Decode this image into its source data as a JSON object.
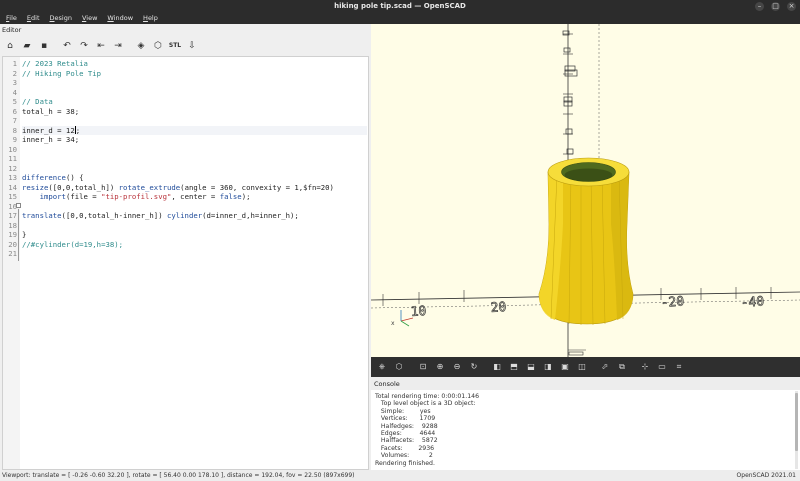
{
  "window": {
    "title": "hiking pole tip.scad — OpenSCAD",
    "minimize": "–",
    "maximize": "□",
    "close": "×"
  },
  "menu": [
    "File",
    "Edit",
    "Design",
    "View",
    "Window",
    "Help"
  ],
  "editor": {
    "header": "Editor",
    "toolbar_icons": [
      "new-icon",
      "open-icon",
      "save-icon",
      "undo-icon",
      "redo-icon",
      "unindent-icon",
      "indent-icon",
      "preview-icon",
      "render-icon",
      "export-stl-icon",
      "send-to-printer-icon"
    ],
    "lines": [
      {
        "n": "1",
        "text": "// 2023 Retalia"
      },
      {
        "n": "2",
        "text": "// Hiking Pole Tip"
      },
      {
        "n": "3",
        "text": ""
      },
      {
        "n": "4",
        "text": ""
      },
      {
        "n": "5",
        "text": "// Data"
      },
      {
        "n": "6",
        "text": "total_h = 38;"
      },
      {
        "n": "7",
        "text": ""
      },
      {
        "n": "8",
        "text": "inner_d = 12;"
      },
      {
        "n": "9",
        "text": "inner_h = 34;"
      },
      {
        "n": "10",
        "text": ""
      },
      {
        "n": "11",
        "text": ""
      },
      {
        "n": "12",
        "text": ""
      },
      {
        "n": "13",
        "text": "difference() {"
      },
      {
        "n": "14",
        "text": "resize([0,0,total_h]) rotate_extrude(angle = 360, convexity = 1,$fn=20)"
      },
      {
        "n": "15",
        "text": "    import(file = \"tip-profil.svg\", center = false);"
      },
      {
        "n": "16",
        "text": ""
      },
      {
        "n": "17",
        "text": "translate([0,0,total_h-inner_h]) cylinder(d=inner_d,h=inner_h);"
      },
      {
        "n": "18",
        "text": ""
      },
      {
        "n": "19",
        "text": "}"
      },
      {
        "n": "20",
        "text": "//#cylinder(d=19,h=38);"
      },
      {
        "n": "21",
        "text": ""
      }
    ]
  },
  "viewport": {
    "axis_labels": [
      "10",
      "20",
      "-20",
      "-40"
    ],
    "axis_id": "x"
  },
  "viewport_toolbar_icons": [
    "preview-icon",
    "render-icon",
    "zoom-all-icon",
    "zoom-in-icon",
    "zoom-out-icon",
    "reset-view-icon",
    "view-right-icon",
    "view-top-icon",
    "view-bottom-icon",
    "view-left-icon",
    "view-front-icon",
    "view-back-icon",
    "perspective-icon",
    "orthogonal-icon",
    "show-axes-icon",
    "show-edges-icon"
  ],
  "console": {
    "title": "Console",
    "lines": [
      "Total rendering time: 0:00:01.146",
      "   Top level object is a 3D object:",
      "   Simple:        yes",
      "   Vertices:      1709",
      "   Halfedges:    9288",
      "   Edges:         4644",
      "   Halffacets:    5872",
      "   Facets:        2936",
      "   Volumes:          2",
      "Rendering finished."
    ]
  },
  "status": {
    "viewport": "Viewport: translate = [ -0.26 -0.60 32.20 ], rotate = [ 56.40 0.00 178.10 ], distance = 192.04, fov = 22.50 (897x699)",
    "version": "OpenSCAD 2021.01"
  },
  "colors": {
    "model": "#f2d21a",
    "viewport_bg": "#fffde7",
    "dark_bar": "#2c2c2c"
  }
}
